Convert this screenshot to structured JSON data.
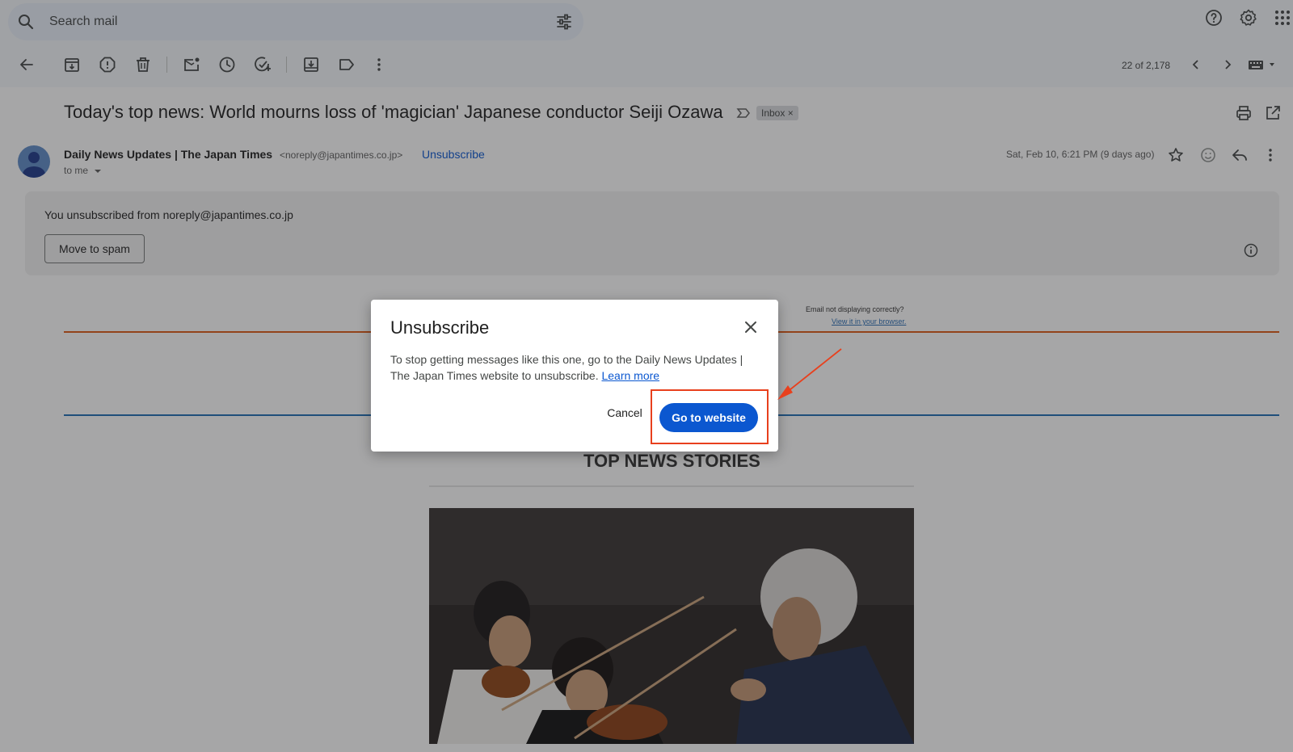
{
  "search": {
    "placeholder": "Search mail"
  },
  "toolbar": {
    "pager": "22 of 2,178"
  },
  "message": {
    "subject": "Today's top news: World mourns loss of 'magician' Japanese conductor Seiji Ozawa",
    "label_chip": "Inbox ×",
    "sender_name": "Daily News Updates | The Japan Times",
    "sender_email": "<noreply@japantimes.co.jp>",
    "unsubscribe_link": "Unsubscribe",
    "to_me": "to me",
    "date": "Sat, Feb 10, 6:21 PM (9 days ago)"
  },
  "notice": {
    "text": "You unsubscribed from noreply@japantimes.co.jp",
    "move_to_spam": "Move to spam"
  },
  "email_body": {
    "not_displaying": "Email not displaying correctly?",
    "view_in_browser": "View it in your browser.",
    "section_heading": "TOP NEWS STORIES"
  },
  "dialog": {
    "title": "Unsubscribe",
    "body": "To stop getting messages like this one, go to the Daily News Updates | The Japan Times website to unsubscribe.",
    "learn_more": "Learn more",
    "cancel": "Cancel",
    "go_to_website": "Go to website"
  },
  "colors": {
    "primary_button": "#0b57d0",
    "annotation": "#e8401d",
    "scrim": "rgba(32,33,36,0.40)"
  },
  "icons": {
    "toolbar": [
      "back-arrow-icon",
      "archive-icon",
      "report-spam-icon",
      "delete-icon",
      "mark-unread-icon",
      "snooze-icon",
      "add-task-icon",
      "move-to-icon",
      "label-icon",
      "more-vert-icon"
    ],
    "header": [
      "help-icon",
      "settings-icon",
      "apps-grid-icon"
    ]
  }
}
